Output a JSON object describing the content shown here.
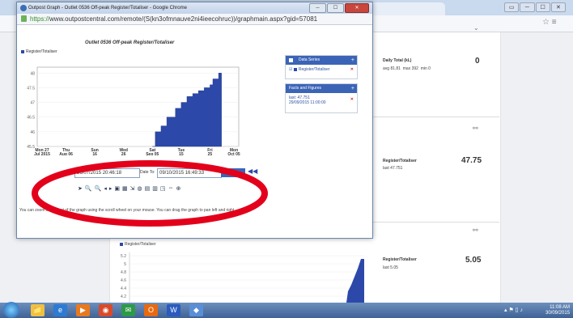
{
  "browser_bg": {
    "window_buttons": [
      "▭",
      "─",
      "☐",
      "✕"
    ],
    "omni_icons": "☆ ≡"
  },
  "background_page": {
    "daily_total": {
      "label": "Daily Total (kL)",
      "value": "0",
      "avg": "avg 81.81",
      "max": "max 392",
      "min": "min 0"
    },
    "register1": {
      "label": "Register/Totaliser",
      "last": "last 47.751",
      "value": "47.75"
    },
    "register2": {
      "label": "Register/Totaliser",
      "last": "last 5.05",
      "value": "5.05"
    },
    "chart2_legend": "Register/Totaliser",
    "chart2_ticks": [
      "5.2",
      "5",
      "4.8",
      "4.6",
      "4.4",
      "4.2"
    ]
  },
  "popup": {
    "title": "Outpost Graph - Outlet 0536 Off-peak Register/Totaliser - Google Chrome",
    "url_https": "https://",
    "url_rest": "www.outpostcentral.com/remote/(S(kn3ofmnauve2ni4ieecohruc))/graphmain.aspx?gid=57081",
    "chart_title": "Outlet 0536 Off-peak Register/Totaliser",
    "legend": "Register/Totaliser",
    "data_series_title": "Data Series",
    "data_series_item": "Register/Totaliser",
    "facts_title": "Facts and Figures",
    "facts_line1": "last: 47.751",
    "facts_line2": "29/09/2015 11:00:00",
    "date_from": "26/07/2015 20:46:18",
    "date_to_label": "Date To:",
    "date_to": "09/10/2015 16:49:33",
    "nav_prev": "◀◀",
    "tools": [
      "➤",
      "🔍",
      "🔍",
      "◂",
      "▸",
      "▣",
      "▦",
      "⇲",
      "◍",
      "▤",
      "▥",
      "◳",
      "⇔",
      "⊕"
    ],
    "help_text": "You can zoom in and out of the graph using the scroll wheel on your mouse. You can drag the graph to pan left and right."
  },
  "chart_data": {
    "type": "area",
    "title": "Outlet 0536 Off-peak Register/Totaliser",
    "series": [
      {
        "name": "Register/Totaliser"
      }
    ],
    "y_ticks": [
      "48",
      "47.5",
      "47",
      "46.5",
      "46",
      "45.5"
    ],
    "x_ticks": [
      {
        "l1": "Mon 27",
        "l2": "Jul 2015"
      },
      {
        "l1": "Thu",
        "l2": "Aug 06"
      },
      {
        "l1": "Sun",
        "l2": "16"
      },
      {
        "l1": "Wed",
        "l2": "26"
      },
      {
        "l1": "Sat",
        "l2": "Sep 05"
      },
      {
        "l1": "Tue",
        "l2": "15"
      },
      {
        "l1": "Fri",
        "l2": "25"
      },
      {
        "l1": "Mon",
        "l2": "Oct 05"
      }
    ],
    "ylim": [
      45.5,
      48.2
    ],
    "x_start": "2015-07-27",
    "x_end": "2015-10-05",
    "steps": [
      {
        "date": "2015-09-05",
        "value": 45.5
      },
      {
        "date": "2015-09-06",
        "value": 46.0
      },
      {
        "date": "2015-09-08",
        "value": 46.2
      },
      {
        "date": "2015-09-10",
        "value": 46.5
      },
      {
        "date": "2015-09-13",
        "value": 46.8
      },
      {
        "date": "2015-09-15",
        "value": 47.0
      },
      {
        "date": "2015-09-17",
        "value": 47.2
      },
      {
        "date": "2015-09-19",
        "value": 47.3
      },
      {
        "date": "2015-09-21",
        "value": 47.4
      },
      {
        "date": "2015-09-23",
        "value": 47.5
      },
      {
        "date": "2015-09-25",
        "value": 47.6
      },
      {
        "date": "2015-09-26",
        "value": 47.8
      },
      {
        "date": "2015-09-28",
        "value": 48.0
      },
      {
        "date": "2015-09-29",
        "value": 48.0
      }
    ],
    "fill": "#2c49a9"
  },
  "taskbar": {
    "apps": [
      "📁",
      "e",
      "▶",
      "◉",
      "✉",
      "O",
      "W",
      "◆"
    ],
    "time": "11:08 AM",
    "date": "30/09/2015",
    "tray": "▴ ⚑ ▯ ♪"
  },
  "colors": {
    "accent": "#3b64b6",
    "highlight_ellipse": "#e3001b"
  }
}
